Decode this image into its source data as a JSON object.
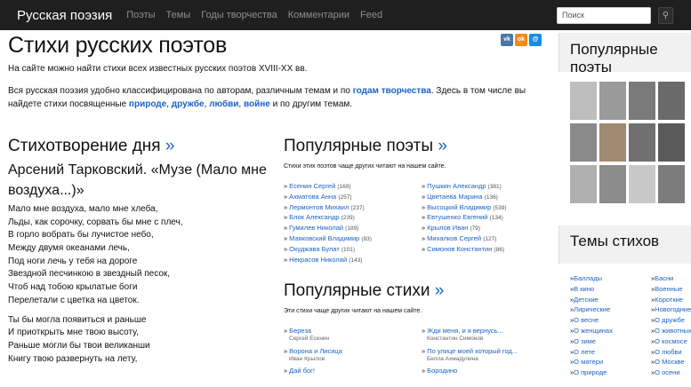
{
  "nav": {
    "brand": "Русская поэзия",
    "links": [
      "Поэты",
      "Темы",
      "Годы творчества",
      "Комментарии",
      "Feed"
    ],
    "search_placeholder": "Поиск",
    "search_icon": "magnifier-icon"
  },
  "page": {
    "title": "Стихи русских поэтов",
    "intro1": "На сайте можно найти стихи всех известных русских поэтов XVIII-XX вв.",
    "intro2_a": "Вся русская поэзия удобно классифицирована по авторам, различным темам и по ",
    "intro2_link1": "годам творчества",
    "intro2_b": ". Здесь в том числе вы найдете стихи посвященные ",
    "kw": [
      "природе",
      "дружбе",
      "любви",
      "войне"
    ],
    "intro2_c": " и по другим темам.",
    "social": [
      "vk",
      "ok",
      "mm"
    ]
  },
  "poem_of_day": {
    "heading": "Стихотворение дня",
    "raquo": "»",
    "title": "Арсений Тарковский. «Музе (Мало мне воздуха...)»",
    "lines": [
      "Мало мне воздуха, мало мне хлеба,",
      "Льды, как сорочку, сорвать бы мне с плеч,",
      "В горло вобрать бы лучистое небо,",
      "Между двумя океанами лечь,",
      "Под ноги лечь у тебя на дороге",
      "Звездной песчинкою в звездный песок,",
      "Чтоб над тобою крылатые боги",
      "Перелетали с цветка на цветок."
    ],
    "lines2": [
      "Ты бы могла появиться и раньше",
      "И приоткрыть мне твою высоту,",
      "Раньше могли бы твои великанши",
      "Книгу твою развернуть на лету,"
    ]
  },
  "popular_poets": {
    "heading": "Популярные поэты",
    "raquo": "»",
    "sub": "Стихи этих поэтов чаще других читают на нашем сайте.",
    "col1": [
      {
        "name": "Есенин Сергей",
        "count": "(169)"
      },
      {
        "name": "Ахматова Анна",
        "count": "(257)"
      },
      {
        "name": "Лермонтов Михаил",
        "count": "(237)"
      },
      {
        "name": "Блок Александр",
        "count": "(239)"
      },
      {
        "name": "Гумилев Николай",
        "count": "(189)"
      },
      {
        "name": "Маяковский Владимир",
        "count": "(83)"
      },
      {
        "name": "Окуджава Булат",
        "count": "(101)"
      },
      {
        "name": "Некрасов Николай",
        "count": "(143)"
      }
    ],
    "col2": [
      {
        "name": "Пушкин Александр",
        "count": "(381)"
      },
      {
        "name": "Цветаева Марина",
        "count": "(136)"
      },
      {
        "name": "Высоцкий Владимир",
        "count": "(539)"
      },
      {
        "name": "Евтушенко Евгений",
        "count": "(134)"
      },
      {
        "name": "Крылов Иван",
        "count": "(79)"
      },
      {
        "name": "Михалков Сергей",
        "count": "(127)"
      },
      {
        "name": "Симонов Константин",
        "count": "(86)"
      }
    ]
  },
  "popular_poems": {
    "heading": "Популярные стихи",
    "raquo": "»",
    "sub": "Эти стихи чаще других читают на нашем сайте.",
    "col1": [
      {
        "title": "Береза",
        "author": "Сергей Есенин"
      },
      {
        "title": "Ворона и Лисица",
        "author": "Иван Крылов"
      },
      {
        "title": "Дай бог!",
        "author": ""
      }
    ],
    "col2": [
      {
        "title": "Жди меня, и я вернусь...",
        "author": "Константин Симонов"
      },
      {
        "title": "По улице моей который год...",
        "author": "Белла Ахмадулина"
      },
      {
        "title": "Бородино",
        "author": ""
      }
    ]
  },
  "sidebar": {
    "popular_heading": "Популярные поэты",
    "themes_heading": "Темы стихов",
    "themes_col1": [
      "Баллады",
      "В кино",
      "Детские",
      "Лирические",
      "О весне",
      "О женщинах",
      "О зиме",
      "О лете",
      "О матери",
      "О природе"
    ],
    "themes_col2": [
      "Басни",
      "Военные",
      "Короткие",
      "Новогодние",
      "О дружбе",
      "О животных",
      "О космосе",
      "О любви",
      "О Москве",
      "О осени"
    ]
  }
}
